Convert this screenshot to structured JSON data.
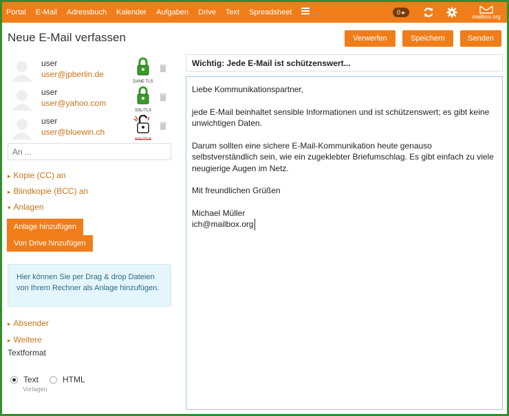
{
  "nav": {
    "items": [
      "Portal",
      "E-Mail",
      "Adressbuch",
      "Kalender",
      "Aufgaben",
      "Drive",
      "Text",
      "Spreadsheet"
    ],
    "menu_icon": "hamburger-icon",
    "badge": "0 ▸",
    "logo_text": "mailbox.org"
  },
  "header": {
    "title": "Neue E-Mail verfassen",
    "discard": "Verwerfen",
    "save": "Speichern",
    "send": "Senden"
  },
  "recipients": [
    {
      "name": "user",
      "email": "user@jpberlin.de",
      "tls": "DANE TLS",
      "tls_color": "#3a9a2a"
    },
    {
      "name": "user",
      "email": "user@yahoo.com",
      "tls": "SSL/TLS",
      "tls_color": "#3a9a2a"
    },
    {
      "name": "user",
      "email": "user@bluewin.ch",
      "tls": "SSL/TLS",
      "tls_color": "#d33"
    }
  ],
  "to_placeholder": "An ...",
  "sections": {
    "cc": "Kopie (CC) an",
    "bcc": "Blindkopie (BCC) an",
    "attachments": "Anlagen",
    "add_attachment": "Anlage hinzufügen",
    "from_drive": "Von Drive hinzufügen",
    "dropzone": "Hier können Sie per Drag & drop Dateien von Ihrem Rechner als Anlage hinzufügen.",
    "sender": "Absender",
    "more": "Weitere",
    "textformat": "Textformat",
    "fmt_text": "Text",
    "fmt_html": "HTML",
    "templates": "Vorlagen"
  },
  "compose": {
    "subject": "Wichtig: Jede E-Mail ist schützenswert...",
    "greeting": "Liebe Kommunikationspartner,",
    "para1": "jede E-Mail beinhaltet sensible Informationen und ist schützenswert; es gibt keine unwichtigen Daten.",
    "para2": "Darum sollten eine sichere E-Mail-Kommunikation heute genauso selbstverständlich sein, wie ein zugeklebter Briefumschlag. Es gibt einfach zu viele neugierige Augen im Netz.",
    "closing": "Mit freundlichen Grüßen",
    "sig_name": "Michael Müller",
    "sig_email": "ich@mailbox.org"
  },
  "colors": {
    "accent": "#f07d19",
    "frame": "#2f8f2c",
    "link": "#c8741a"
  }
}
